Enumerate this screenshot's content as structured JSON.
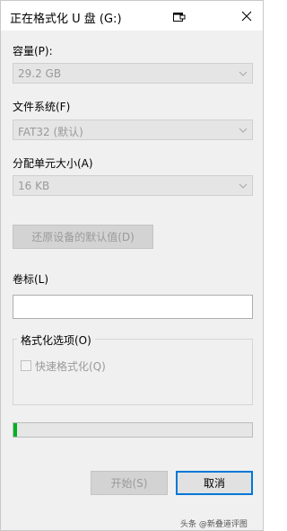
{
  "window": {
    "title": "正在格式化 U 盘 (G:)"
  },
  "capacity": {
    "label": "容量(P):",
    "value": "29.2 GB"
  },
  "filesystem": {
    "label": "文件系统(F)",
    "value": "FAT32 (默认)"
  },
  "allocation": {
    "label": "分配单元大小(A)",
    "value": "16 KB"
  },
  "restore_defaults_label": "还原设备的默认值(D)",
  "volume": {
    "label": "卷标(L)",
    "value": ""
  },
  "format_options": {
    "legend": "格式化选项(O)",
    "quick_format_label": "快速格式化(Q)",
    "quick_format_checked": false
  },
  "progress": {
    "fraction": 0.015,
    "color": "#06b025"
  },
  "buttons": {
    "start_label": "开始(S)",
    "cancel_label": "取消"
  },
  "accent_color": "#0078d7",
  "watermark": "头条 @新叠道评图"
}
